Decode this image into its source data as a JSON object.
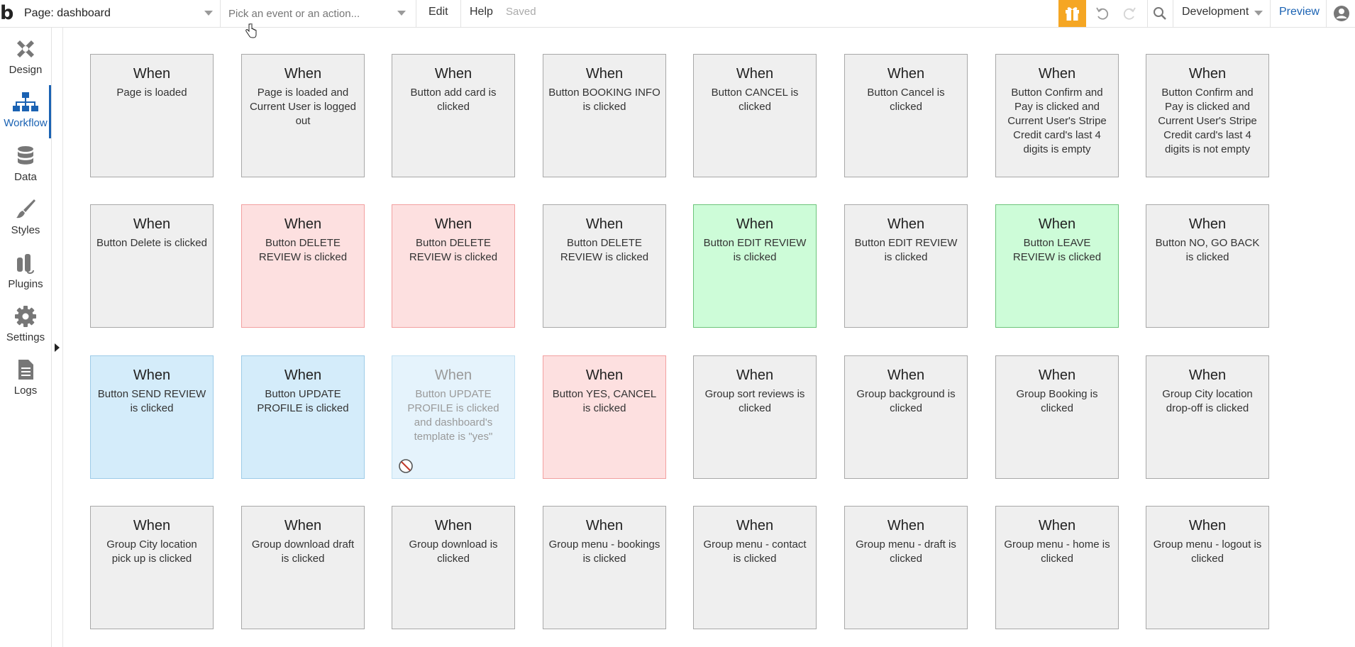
{
  "header": {
    "page_label": "Page: dashboard",
    "event_placeholder": "Pick an event or an action...",
    "menu": [
      "Edit",
      "Help"
    ],
    "saved": "Saved",
    "environment": "Development",
    "preview": "Preview",
    "brand_color": "#f5a623",
    "link_color": "#1a62b3"
  },
  "sidebar": {
    "items": [
      {
        "label": "Design",
        "icon": "design-icon"
      },
      {
        "label": "Workflow",
        "icon": "workflow-icon",
        "active": true
      },
      {
        "label": "Data",
        "icon": "database-icon"
      },
      {
        "label": "Styles",
        "icon": "brush-icon"
      },
      {
        "label": "Plugins",
        "icon": "plugin-icon"
      },
      {
        "label": "Settings",
        "icon": "gear-icon"
      },
      {
        "label": "Logs",
        "icon": "document-icon"
      }
    ]
  },
  "workflows": [
    {
      "when": "When",
      "desc": "Page is loaded",
      "color": "gray"
    },
    {
      "when": "When",
      "desc": "Page is loaded and Current User is logged out",
      "color": "gray"
    },
    {
      "when": "When",
      "desc": "Button add card is clicked",
      "color": "gray"
    },
    {
      "when": "When",
      "desc": "Button BOOKING INFO is clicked",
      "color": "gray"
    },
    {
      "when": "When",
      "desc": "Button CANCEL is clicked",
      "color": "gray"
    },
    {
      "when": "When",
      "desc": "Button Cancel is clicked",
      "color": "gray"
    },
    {
      "when": "When",
      "desc": "Button Confirm and Pay is clicked and Current User's Stripe Credit card's last 4 digits is empty",
      "color": "gray"
    },
    {
      "when": "When",
      "desc": "Button Confirm and Pay is clicked and Current User's Stripe Credit card's last 4 digits is not empty",
      "color": "gray"
    },
    {
      "when": "When",
      "desc": "Button Delete is clicked",
      "color": "gray"
    },
    {
      "when": "When",
      "desc": "Button DELETE REVIEW is clicked",
      "color": "red"
    },
    {
      "when": "When",
      "desc": "Button DELETE REVIEW is clicked",
      "color": "red"
    },
    {
      "when": "When",
      "desc": "Button DELETE REVIEW is clicked",
      "color": "gray"
    },
    {
      "when": "When",
      "desc": "Button EDIT REVIEW is clicked",
      "color": "green"
    },
    {
      "when": "When",
      "desc": "Button EDIT REVIEW is clicked",
      "color": "gray"
    },
    {
      "when": "When",
      "desc": "Button LEAVE REVIEW is clicked",
      "color": "green"
    },
    {
      "when": "When",
      "desc": "Button NO, GO BACK is clicked",
      "color": "gray"
    },
    {
      "when": "When",
      "desc": "Button SEND REVIEW is clicked",
      "color": "blue"
    },
    {
      "when": "When",
      "desc": "Button UPDATE PROFILE is clicked",
      "color": "blue"
    },
    {
      "when": "When",
      "desc": "Button UPDATE PROFILE is clicked and dashboard's template is \"yes\"",
      "color": "disabled"
    },
    {
      "when": "When",
      "desc": "Button YES, CANCEL is clicked",
      "color": "red"
    },
    {
      "when": "When",
      "desc": "Group sort reviews is clicked",
      "color": "gray"
    },
    {
      "when": "When",
      "desc": "Group background is clicked",
      "color": "gray"
    },
    {
      "when": "When",
      "desc": "Group Booking is clicked",
      "color": "gray"
    },
    {
      "when": "When",
      "desc": "Group City location drop-off is clicked",
      "color": "gray"
    },
    {
      "when": "When",
      "desc": "Group City location pick up is clicked",
      "color": "gray"
    },
    {
      "when": "When",
      "desc": "Group download draft is clicked",
      "color": "gray"
    },
    {
      "when": "When",
      "desc": "Group download is clicked",
      "color": "gray"
    },
    {
      "when": "When",
      "desc": "Group menu - bookings is clicked",
      "color": "gray"
    },
    {
      "when": "When",
      "desc": "Group menu - contact is clicked",
      "color": "gray"
    },
    {
      "when": "When",
      "desc": "Group menu - draft is clicked",
      "color": "gray"
    },
    {
      "when": "When",
      "desc": "Group menu - home is clicked",
      "color": "gray"
    },
    {
      "when": "When",
      "desc": "Group menu - logout is clicked",
      "color": "gray"
    }
  ]
}
